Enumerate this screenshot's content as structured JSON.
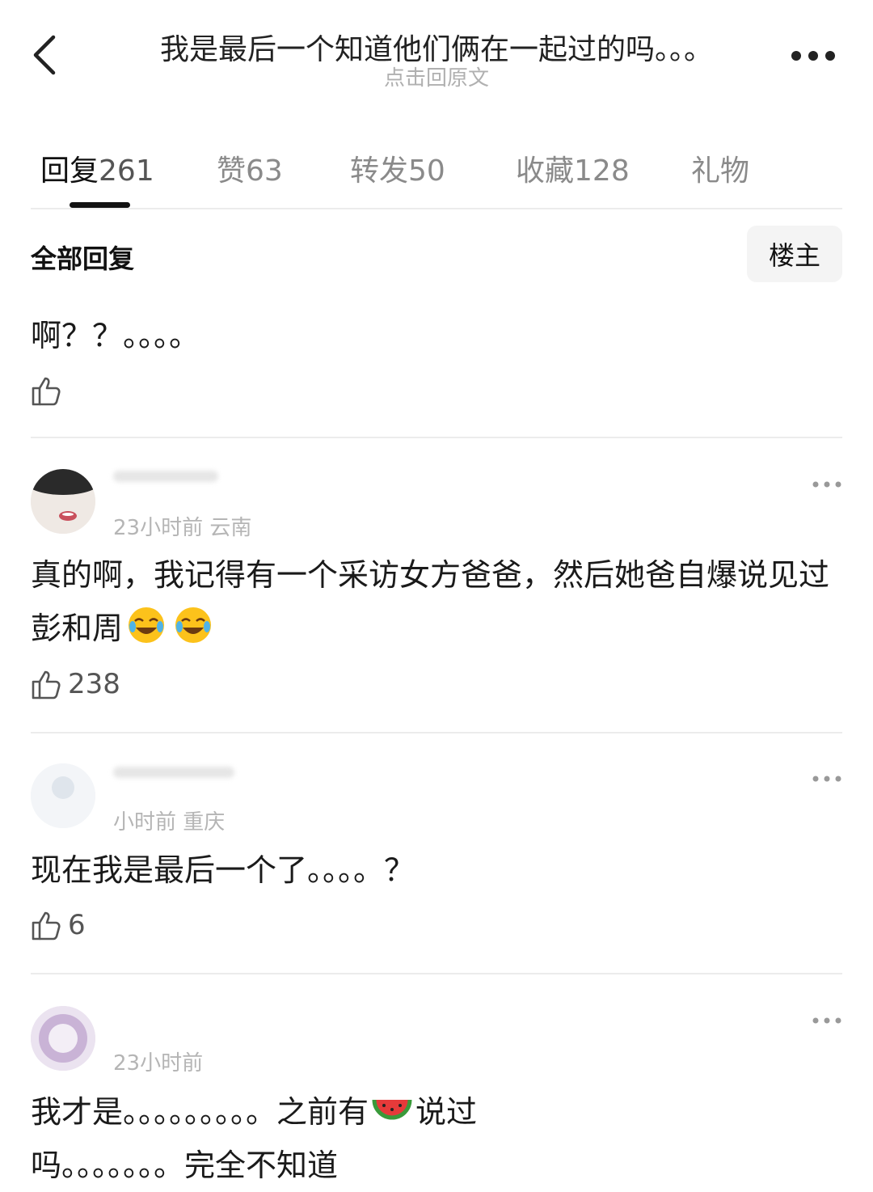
{
  "header": {
    "title": "我是最后一个知道他们俩在一起过的吗。。。",
    "subtitle": "点击回原文"
  },
  "tabs": [
    {
      "label": "回复",
      "count": "261"
    },
    {
      "label": "赞",
      "count": "63"
    },
    {
      "label": "转发",
      "count": "50"
    },
    {
      "label": "收藏",
      "count": "128"
    },
    {
      "label": "礼物",
      "count": ""
    }
  ],
  "filter": {
    "label": "全部回复",
    "owner_button": "楼主"
  },
  "comments": [
    {
      "meta": "",
      "text": "啊？？。。。。",
      "likes": ""
    },
    {
      "meta": "23小时前 云南",
      "text_a": "真的啊，我记得有一个采访女方爸爸，然后她爸自爆说见过彭和周",
      "likes": "238"
    },
    {
      "meta": "小时前 重庆",
      "text": "现在我是最后一个了。。。。？",
      "likes": "6"
    },
    {
      "meta": "23小时前",
      "line1_a": "我才是。。。。。。。。。之前有",
      "line1_b": "说过",
      "line2": "吗。。。。。。。完全不知道"
    }
  ],
  "icons": {
    "back": "chevron-left-icon",
    "more": "more-dots-icon",
    "like": "thumbs-up-icon",
    "emoji_laugh": "tears-of-joy-emoji",
    "emoji_watermelon": "watermelon-emoji"
  },
  "colors": {
    "text": "#1a1a1a",
    "muted": "#8a8a8a",
    "divider": "#ececec"
  }
}
